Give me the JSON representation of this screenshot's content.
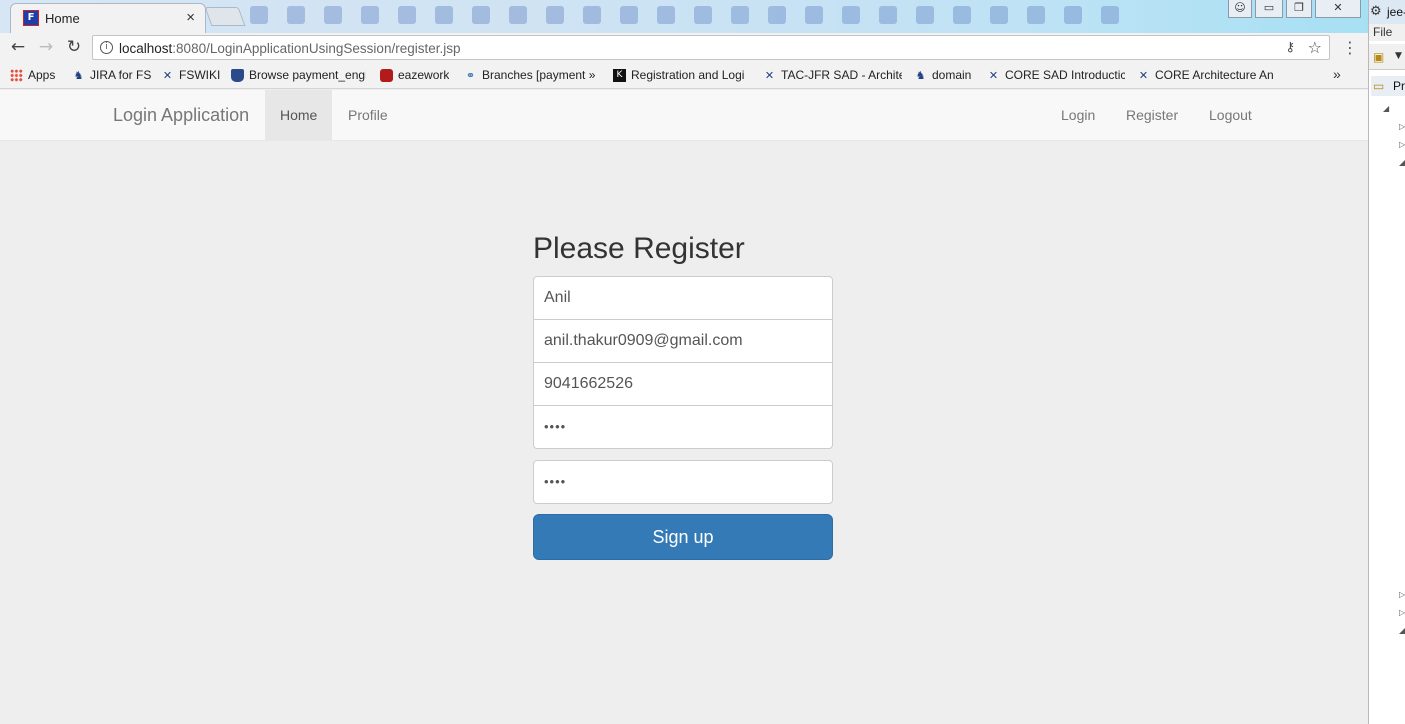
{
  "browser": {
    "tab_title": "Home",
    "tab_close": "×",
    "url_host": "localhost",
    "url_rest": ":8080/LoginApplicationUsingSession/register.jsp",
    "window_buttons": {
      "minimize": "▭",
      "maximize": "❐",
      "close": "✕"
    },
    "bookmarks": [
      {
        "label": "Apps",
        "icon": "apps-grid-icon"
      },
      {
        "label": "JIRA for FS",
        "icon": "jira-icon"
      },
      {
        "label": "FSWIKI",
        "icon": "confluence-icon"
      },
      {
        "label": "Browse payment_engi",
        "icon": "database-icon"
      },
      {
        "label": "eazework",
        "icon": "eazework-icon"
      },
      {
        "label": "Branches [payment »",
        "icon": "branch-icon"
      },
      {
        "label": "Registration and Logi",
        "icon": "k-icon"
      },
      {
        "label": "TAC-JFR SAD - Archite",
        "icon": "confluence-icon"
      },
      {
        "label": "domain",
        "icon": "jira-icon"
      },
      {
        "label": "CORE SAD Introductic",
        "icon": "confluence-icon"
      },
      {
        "label": "CORE Architecture An",
        "icon": "confluence-icon"
      }
    ],
    "bookmarks_more": "»"
  },
  "ide": {
    "title": "jee-",
    "menu_file": "File",
    "view_title": "Pro"
  },
  "navbar": {
    "brand": "Login Application",
    "left_links": [
      "Home",
      "Profile"
    ],
    "right_links": [
      "Login",
      "Register",
      "Logout"
    ]
  },
  "form": {
    "title": "Please Register",
    "name_value": "Anil",
    "email_value": "anil.thakur0909@gmail.com",
    "phone_value": "9041662526",
    "password_value": "••••",
    "confirm_password_value": "••••",
    "submit_label": "Sign up"
  }
}
